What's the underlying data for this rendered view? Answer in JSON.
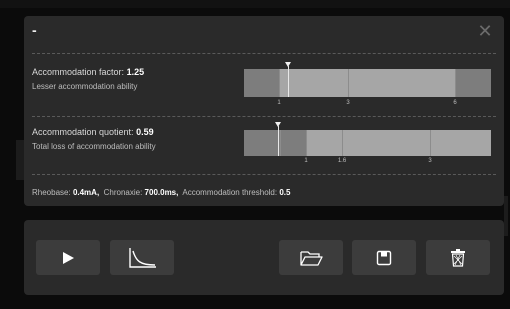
{
  "dialog": {
    "title": "-",
    "close_icon": "close-icon"
  },
  "factor": {
    "label": "Accommodation factor:",
    "value": "1.25",
    "description": "Lesser accommodation ability",
    "ticks": [
      "1",
      "3",
      "6"
    ],
    "marker_value": 1.25
  },
  "quotient": {
    "label": "Accommodation quotient:",
    "value": "0.59",
    "description": "Total loss of accommodation ability",
    "ticks": [
      "1",
      "1.6",
      "3"
    ],
    "marker_value": 0.59
  },
  "summary": {
    "rheobase_label": "Rheobase:",
    "rheobase_value": "0.4mA,",
    "chronaxie_label": "Chronaxie:",
    "chronaxie_value": "700.0ms,",
    "threshold_label": "Accommodation threshold:",
    "threshold_value": "0.5"
  },
  "toolbar": {
    "play_icon": "play-icon",
    "curve_icon": "curve-chart-icon",
    "open_icon": "folder-open-icon",
    "save_icon": "save-icon",
    "delete_icon": "trash-icon"
  },
  "colors": {
    "panel": "#2a2a2a",
    "button": "#3c3c3c",
    "scale_dark": "#7d7d7d",
    "scale_light": "#a6a6a6",
    "marker": "#f0f0f0"
  }
}
